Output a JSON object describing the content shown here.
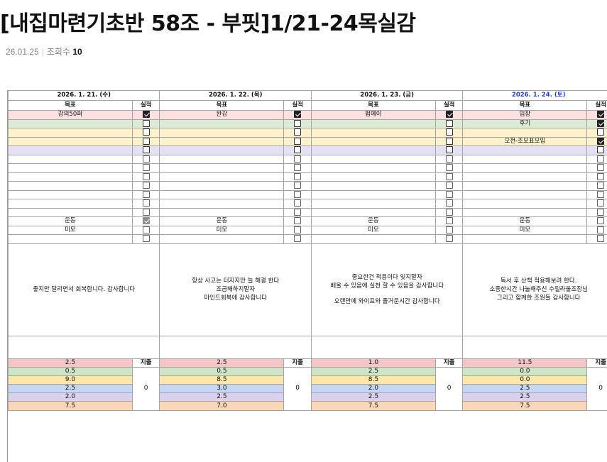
{
  "post": {
    "title": "[내집마련기초반 58조 - 부핏]1/21-24목실감",
    "date": "26.01.25",
    "views_label": "조회수",
    "views_count": "10"
  },
  "sheet": {
    "goal_header": "목표",
    "result_header": "실적",
    "spend_header": "지출",
    "days": [
      {
        "date": "2026. 1. 21. (수)",
        "saturday": false,
        "goals": [
          "강의50퍼",
          "",
          "",
          "",
          "",
          "",
          "",
          "",
          "",
          "",
          "",
          "",
          "운동",
          "미모",
          ""
        ],
        "checks": [
          "on",
          "off",
          "off",
          "off",
          "off",
          "off",
          "off",
          "off",
          "off",
          "off",
          "off",
          "off",
          "grey",
          "off",
          "off"
        ],
        "note": [
          "좋지만 달리면서 회복합니다. 감사합니다"
        ],
        "amounts": [
          "2.5",
          "0.5",
          "9.0",
          "2.5",
          "2.0",
          "7.5"
        ],
        "spend": "0"
      },
      {
        "date": "2026. 1. 22. (목)",
        "saturday": false,
        "goals": [
          "완강",
          "",
          "",
          "",
          "",
          "",
          "",
          "",
          "",
          "",
          "",
          "",
          "운동",
          "미모",
          ""
        ],
        "checks": [
          "on",
          "off",
          "off",
          "off",
          "off",
          "off",
          "off",
          "off",
          "off",
          "off",
          "off",
          "off",
          "off",
          "off",
          "off"
        ],
        "note": [
          "항상 사고는 터지지만 늘 해결 한다",
          "조급해하지말자",
          "마인드회복에 감사합니다"
        ],
        "amounts": [
          "2.5",
          "0.5",
          "8.5",
          "3.0",
          "2.5",
          "7.0"
        ],
        "spend": "0"
      },
      {
        "date": "2026. 1. 23. (금)",
        "saturday": false,
        "goals": [
          "펌메이",
          "",
          "",
          "",
          "",
          "",
          "",
          "",
          "",
          "",
          "",
          "",
          "운동",
          "미모",
          ""
        ],
        "checks": [
          "on",
          "off",
          "off",
          "off",
          "off",
          "off",
          "off",
          "off",
          "off",
          "off",
          "off",
          "off",
          "off",
          "off",
          "off"
        ],
        "note": [
          "중요한건 적용이다 잊지말자",
          "배울 수 있음에 실천 할 수 있음을 감사합니다",
          "",
          "오랜만에 와이프와 즐거운시간 감사합니다"
        ],
        "amounts": [
          "1.0",
          "2.5",
          "8.5",
          "2.0",
          "2.5",
          "7.5"
        ],
        "spend": "0"
      },
      {
        "date": "2026. 1. 24. (토)",
        "saturday": true,
        "goals": [
          "임장",
          "후기",
          "",
          "오전-조모표모임",
          "",
          "",
          "",
          "",
          "",
          "",
          "",
          "",
          "운동",
          "미모",
          ""
        ],
        "checks": [
          "on",
          "on",
          "off",
          "on",
          "off",
          "off",
          "off",
          "off",
          "off",
          "off",
          "off",
          "off",
          "off",
          "off",
          "off"
        ],
        "note": [
          "독서 후 산책 적용해보려 한다.",
          "소중한시간 나눌해주신 수필라울조장님",
          "그리고 함께한 조원들 감사합니다"
        ],
        "amounts": [
          "11.5",
          "0.0",
          "0.0",
          "2.5",
          "2.5",
          "7.5"
        ],
        "spend": "0"
      }
    ]
  },
  "colors": {
    "saturday_date": "#2a3de0",
    "row_bands": [
      "#fde0e0",
      "#dcebd6",
      "#fdf2cc",
      "#e6e0f5"
    ],
    "amount_bands": [
      "#f6c6c6",
      "#cfe6c6",
      "#fde6a6",
      "#c6d6f5",
      "#dcd0ef",
      "#fcd7b6"
    ]
  }
}
